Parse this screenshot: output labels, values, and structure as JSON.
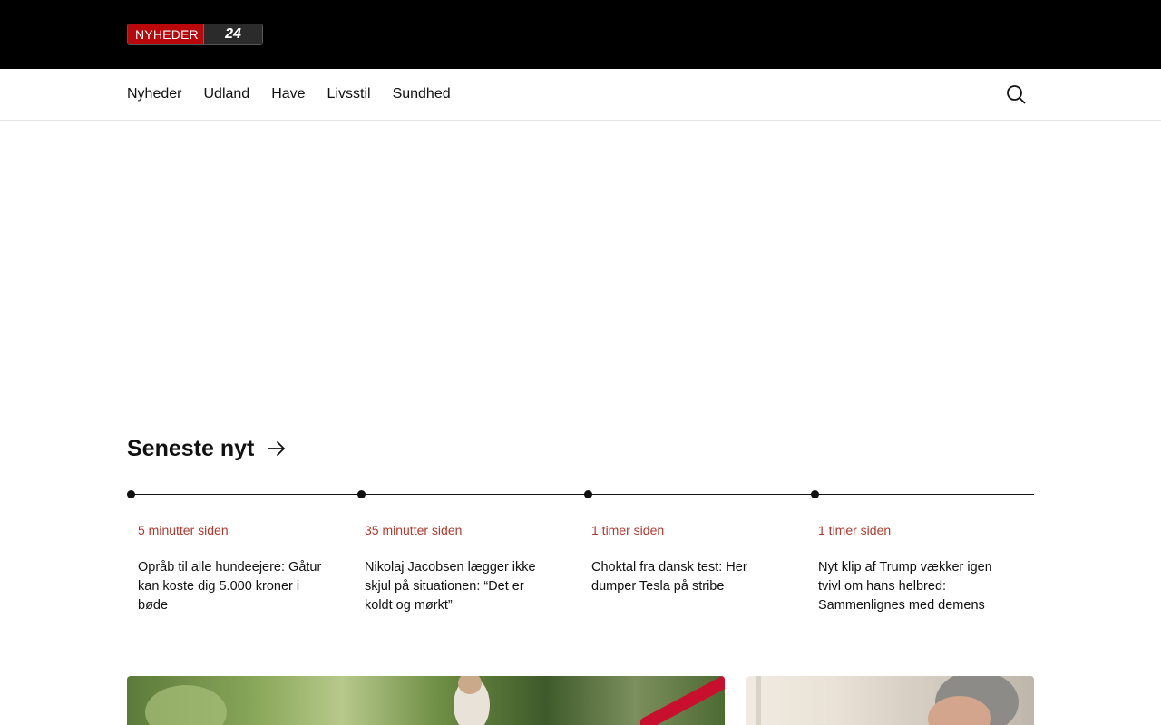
{
  "logo": {
    "part1": "NYHEDER",
    "part2": "24"
  },
  "nav": {
    "items": [
      "Nyheder",
      "Udland",
      "Have",
      "Livsstil",
      "Sundhed"
    ],
    "search_icon": "search-icon"
  },
  "latest": {
    "title": "Seneste nyt",
    "arrow_icon": "arrow-right-icon",
    "items": [
      {
        "time": "5 minutter siden",
        "title": "Opråb til alle hundeejere: Gåtur kan koste dig 5.000 kroner i bøde"
      },
      {
        "time": "35 minutter siden",
        "title": "Nikolaj Jacobsen lægger ikke skjul på situationen: “Det er koldt og mørkt”"
      },
      {
        "time": "1 timer siden",
        "title": "Choktal fra dansk test: Her dumper Tesla på stribe"
      },
      {
        "time": "1 timer siden",
        "title": "Nyt klip af Trump vækker igen tvivl om hans helbred: Sammenlignes med demens"
      }
    ]
  },
  "colors": {
    "brand_red": "#b8080c",
    "time_red": "#b03a2e",
    "topbar": "#000000"
  }
}
